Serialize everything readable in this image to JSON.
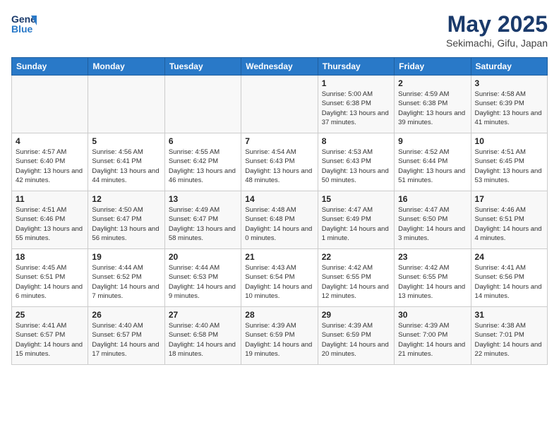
{
  "header": {
    "logo_line1": "General",
    "logo_line2": "Blue",
    "month": "May 2025",
    "location": "Sekimachi, Gifu, Japan"
  },
  "weekdays": [
    "Sunday",
    "Monday",
    "Tuesday",
    "Wednesday",
    "Thursday",
    "Friday",
    "Saturday"
  ],
  "weeks": [
    [
      {
        "day": "",
        "info": ""
      },
      {
        "day": "",
        "info": ""
      },
      {
        "day": "",
        "info": ""
      },
      {
        "day": "",
        "info": ""
      },
      {
        "day": "1",
        "info": "Sunrise: 5:00 AM\nSunset: 6:38 PM\nDaylight: 13 hours\nand 37 minutes."
      },
      {
        "day": "2",
        "info": "Sunrise: 4:59 AM\nSunset: 6:38 PM\nDaylight: 13 hours\nand 39 minutes."
      },
      {
        "day": "3",
        "info": "Sunrise: 4:58 AM\nSunset: 6:39 PM\nDaylight: 13 hours\nand 41 minutes."
      }
    ],
    [
      {
        "day": "4",
        "info": "Sunrise: 4:57 AM\nSunset: 6:40 PM\nDaylight: 13 hours\nand 42 minutes."
      },
      {
        "day": "5",
        "info": "Sunrise: 4:56 AM\nSunset: 6:41 PM\nDaylight: 13 hours\nand 44 minutes."
      },
      {
        "day": "6",
        "info": "Sunrise: 4:55 AM\nSunset: 6:42 PM\nDaylight: 13 hours\nand 46 minutes."
      },
      {
        "day": "7",
        "info": "Sunrise: 4:54 AM\nSunset: 6:43 PM\nDaylight: 13 hours\nand 48 minutes."
      },
      {
        "day": "8",
        "info": "Sunrise: 4:53 AM\nSunset: 6:43 PM\nDaylight: 13 hours\nand 50 minutes."
      },
      {
        "day": "9",
        "info": "Sunrise: 4:52 AM\nSunset: 6:44 PM\nDaylight: 13 hours\nand 51 minutes."
      },
      {
        "day": "10",
        "info": "Sunrise: 4:51 AM\nSunset: 6:45 PM\nDaylight: 13 hours\nand 53 minutes."
      }
    ],
    [
      {
        "day": "11",
        "info": "Sunrise: 4:51 AM\nSunset: 6:46 PM\nDaylight: 13 hours\nand 55 minutes."
      },
      {
        "day": "12",
        "info": "Sunrise: 4:50 AM\nSunset: 6:47 PM\nDaylight: 13 hours\nand 56 minutes."
      },
      {
        "day": "13",
        "info": "Sunrise: 4:49 AM\nSunset: 6:47 PM\nDaylight: 13 hours\nand 58 minutes."
      },
      {
        "day": "14",
        "info": "Sunrise: 4:48 AM\nSunset: 6:48 PM\nDaylight: 14 hours\nand 0 minutes."
      },
      {
        "day": "15",
        "info": "Sunrise: 4:47 AM\nSunset: 6:49 PM\nDaylight: 14 hours\nand 1 minute."
      },
      {
        "day": "16",
        "info": "Sunrise: 4:47 AM\nSunset: 6:50 PM\nDaylight: 14 hours\nand 3 minutes."
      },
      {
        "day": "17",
        "info": "Sunrise: 4:46 AM\nSunset: 6:51 PM\nDaylight: 14 hours\nand 4 minutes."
      }
    ],
    [
      {
        "day": "18",
        "info": "Sunrise: 4:45 AM\nSunset: 6:51 PM\nDaylight: 14 hours\nand 6 minutes."
      },
      {
        "day": "19",
        "info": "Sunrise: 4:44 AM\nSunset: 6:52 PM\nDaylight: 14 hours\nand 7 minutes."
      },
      {
        "day": "20",
        "info": "Sunrise: 4:44 AM\nSunset: 6:53 PM\nDaylight: 14 hours\nand 9 minutes."
      },
      {
        "day": "21",
        "info": "Sunrise: 4:43 AM\nSunset: 6:54 PM\nDaylight: 14 hours\nand 10 minutes."
      },
      {
        "day": "22",
        "info": "Sunrise: 4:42 AM\nSunset: 6:55 PM\nDaylight: 14 hours\nand 12 minutes."
      },
      {
        "day": "23",
        "info": "Sunrise: 4:42 AM\nSunset: 6:55 PM\nDaylight: 14 hours\nand 13 minutes."
      },
      {
        "day": "24",
        "info": "Sunrise: 4:41 AM\nSunset: 6:56 PM\nDaylight: 14 hours\nand 14 minutes."
      }
    ],
    [
      {
        "day": "25",
        "info": "Sunrise: 4:41 AM\nSunset: 6:57 PM\nDaylight: 14 hours\nand 15 minutes."
      },
      {
        "day": "26",
        "info": "Sunrise: 4:40 AM\nSunset: 6:57 PM\nDaylight: 14 hours\nand 17 minutes."
      },
      {
        "day": "27",
        "info": "Sunrise: 4:40 AM\nSunset: 6:58 PM\nDaylight: 14 hours\nand 18 minutes."
      },
      {
        "day": "28",
        "info": "Sunrise: 4:39 AM\nSunset: 6:59 PM\nDaylight: 14 hours\nand 19 minutes."
      },
      {
        "day": "29",
        "info": "Sunrise: 4:39 AM\nSunset: 6:59 PM\nDaylight: 14 hours\nand 20 minutes."
      },
      {
        "day": "30",
        "info": "Sunrise: 4:39 AM\nSunset: 7:00 PM\nDaylight: 14 hours\nand 21 minutes."
      },
      {
        "day": "31",
        "info": "Sunrise: 4:38 AM\nSunset: 7:01 PM\nDaylight: 14 hours\nand 22 minutes."
      }
    ]
  ]
}
